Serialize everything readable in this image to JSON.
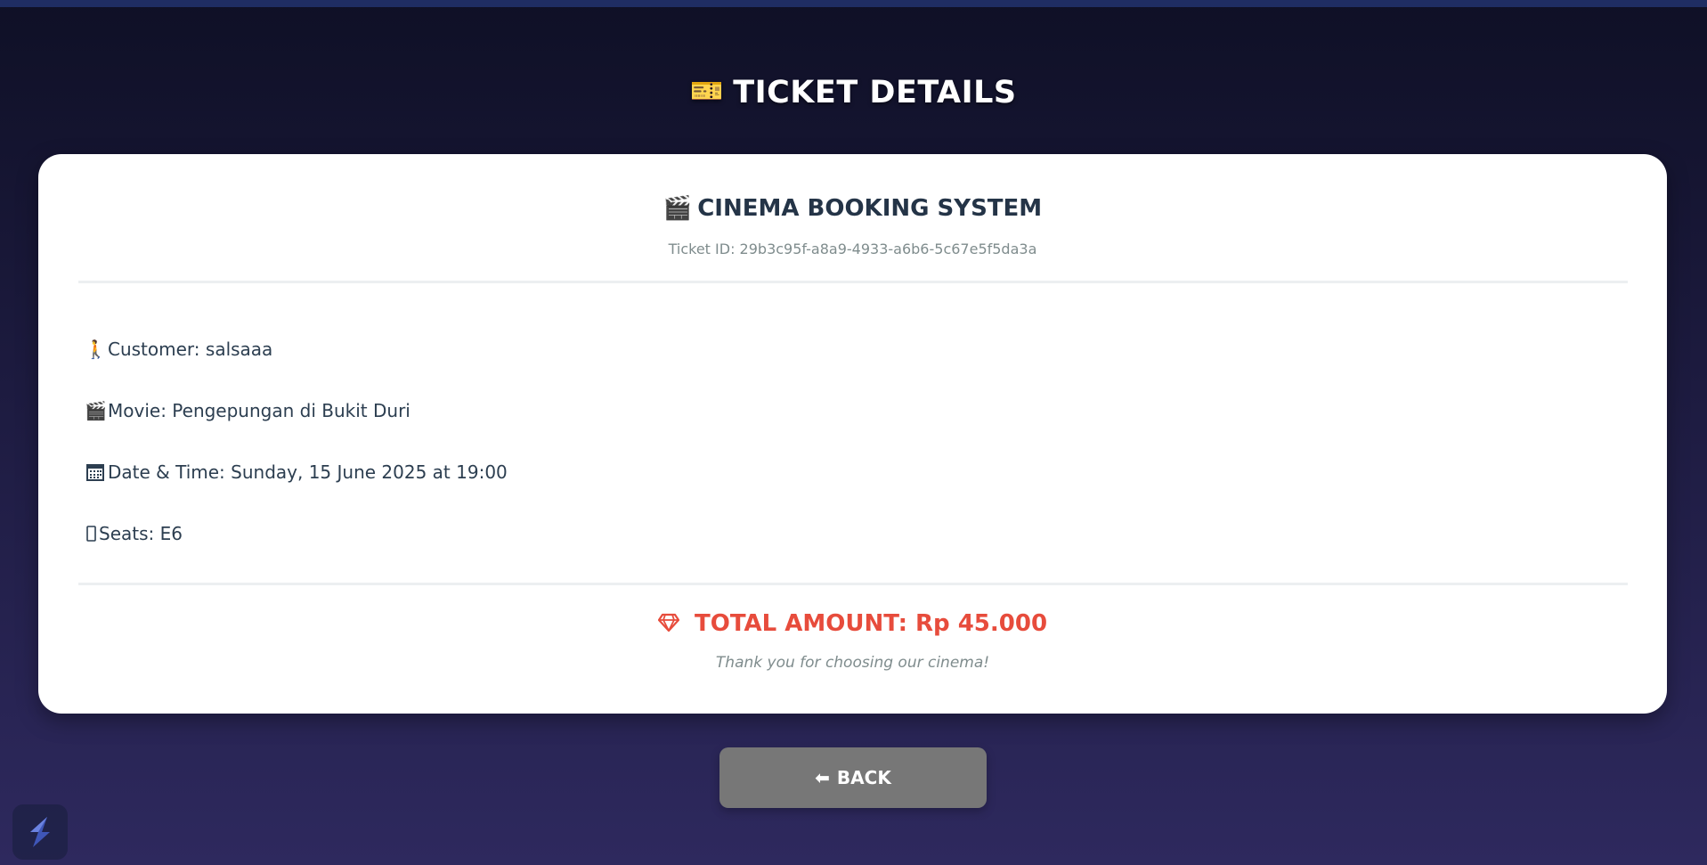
{
  "header": {
    "icon": "ticket-icon",
    "title": "TICKET DETAILS"
  },
  "ticket": {
    "system_icon": "clapperboard-icon",
    "system_title": "CINEMA BOOKING SYSTEM",
    "ticket_id": "Ticket ID: 29b3c95f-a8a9-4933-a6b6-5c67e5f5da3a",
    "details": {
      "customer": {
        "icon": "person-icon",
        "text": "Customer: salsaaa"
      },
      "movie": {
        "icon": "clapperboard-icon",
        "text": "Movie: Pengepungan di Bukit Duri"
      },
      "datetime": {
        "icon": "calendar-icon",
        "text": "Date & Time: Sunday, 15 June 2025 at 19:00"
      },
      "seats": {
        "icon": "seat-icon",
        "text": "Seats: E6"
      }
    },
    "total_icon": "gem-icon",
    "total": "TOTAL AMOUNT: Rp 45.000",
    "thanks": "Thank you for choosing our cinema!"
  },
  "actions": {
    "back_icon": "left-arrow-icon",
    "back_label": "BACK"
  },
  "colors": {
    "total_accent": "#e74c3c",
    "text_dark": "#2c3e50",
    "muted": "#7f8c8d",
    "button_bg": "#777777",
    "background_top": "#0f1026",
    "background_bottom": "#2e295e"
  }
}
